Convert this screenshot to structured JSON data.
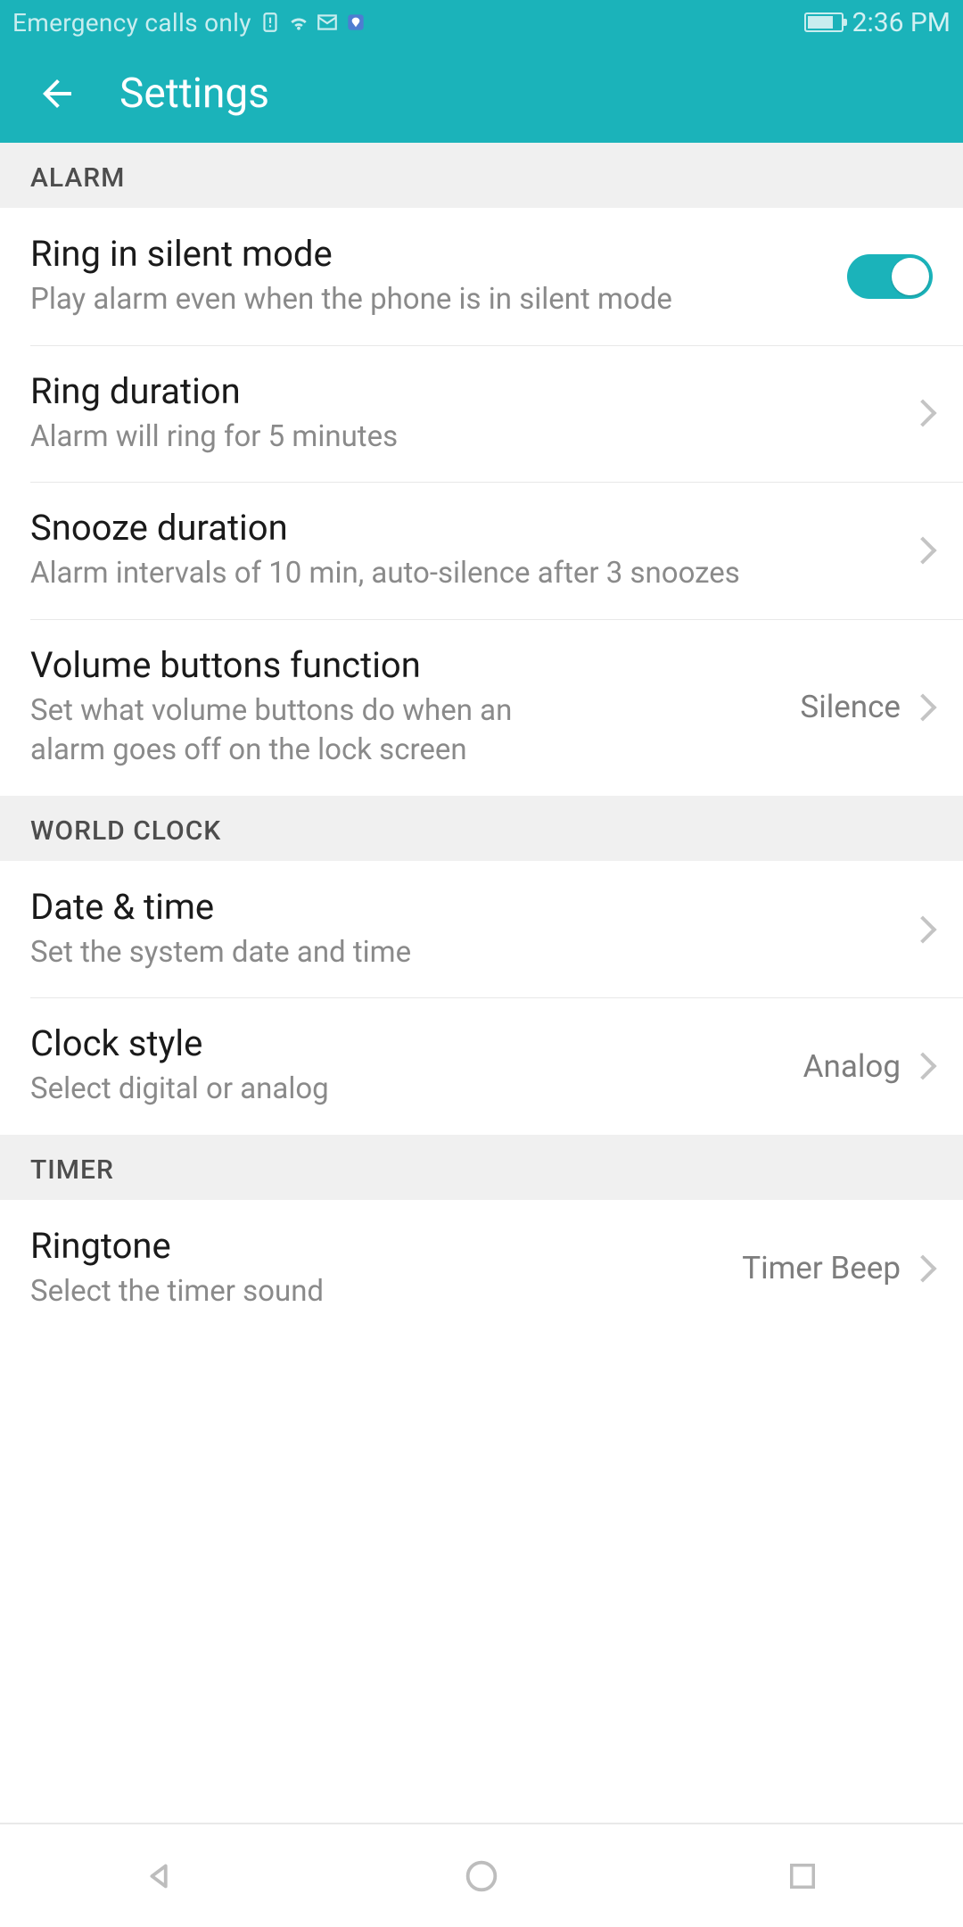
{
  "status": {
    "network_text": "Emergency calls only",
    "time": "2:36 PM"
  },
  "header": {
    "title": "Settings"
  },
  "sections": {
    "alarm": {
      "header": "ALARM",
      "ring_silent": {
        "title": "Ring in silent mode",
        "sub": "Play alarm even when the phone is in silent mode",
        "enabled": true
      },
      "ring_duration": {
        "title": "Ring duration",
        "sub": "Alarm will ring for 5 minutes"
      },
      "snooze_duration": {
        "title": "Snooze duration",
        "sub": "Alarm intervals of 10 min, auto-silence after 3 snoozes"
      },
      "volume_buttons": {
        "title": "Volume buttons function",
        "sub": "Set what volume buttons do when an alarm goes off on the lock screen",
        "value": "Silence"
      }
    },
    "world_clock": {
      "header": "WORLD CLOCK",
      "date_time": {
        "title": "Date & time",
        "sub": "Set the system date and time"
      },
      "clock_style": {
        "title": "Clock style",
        "sub": "Select digital or analog",
        "value": "Analog"
      }
    },
    "timer": {
      "header": "TIMER",
      "ringtone": {
        "title": "Ringtone",
        "sub": "Select the timer sound",
        "value": "Timer Beep"
      }
    }
  }
}
